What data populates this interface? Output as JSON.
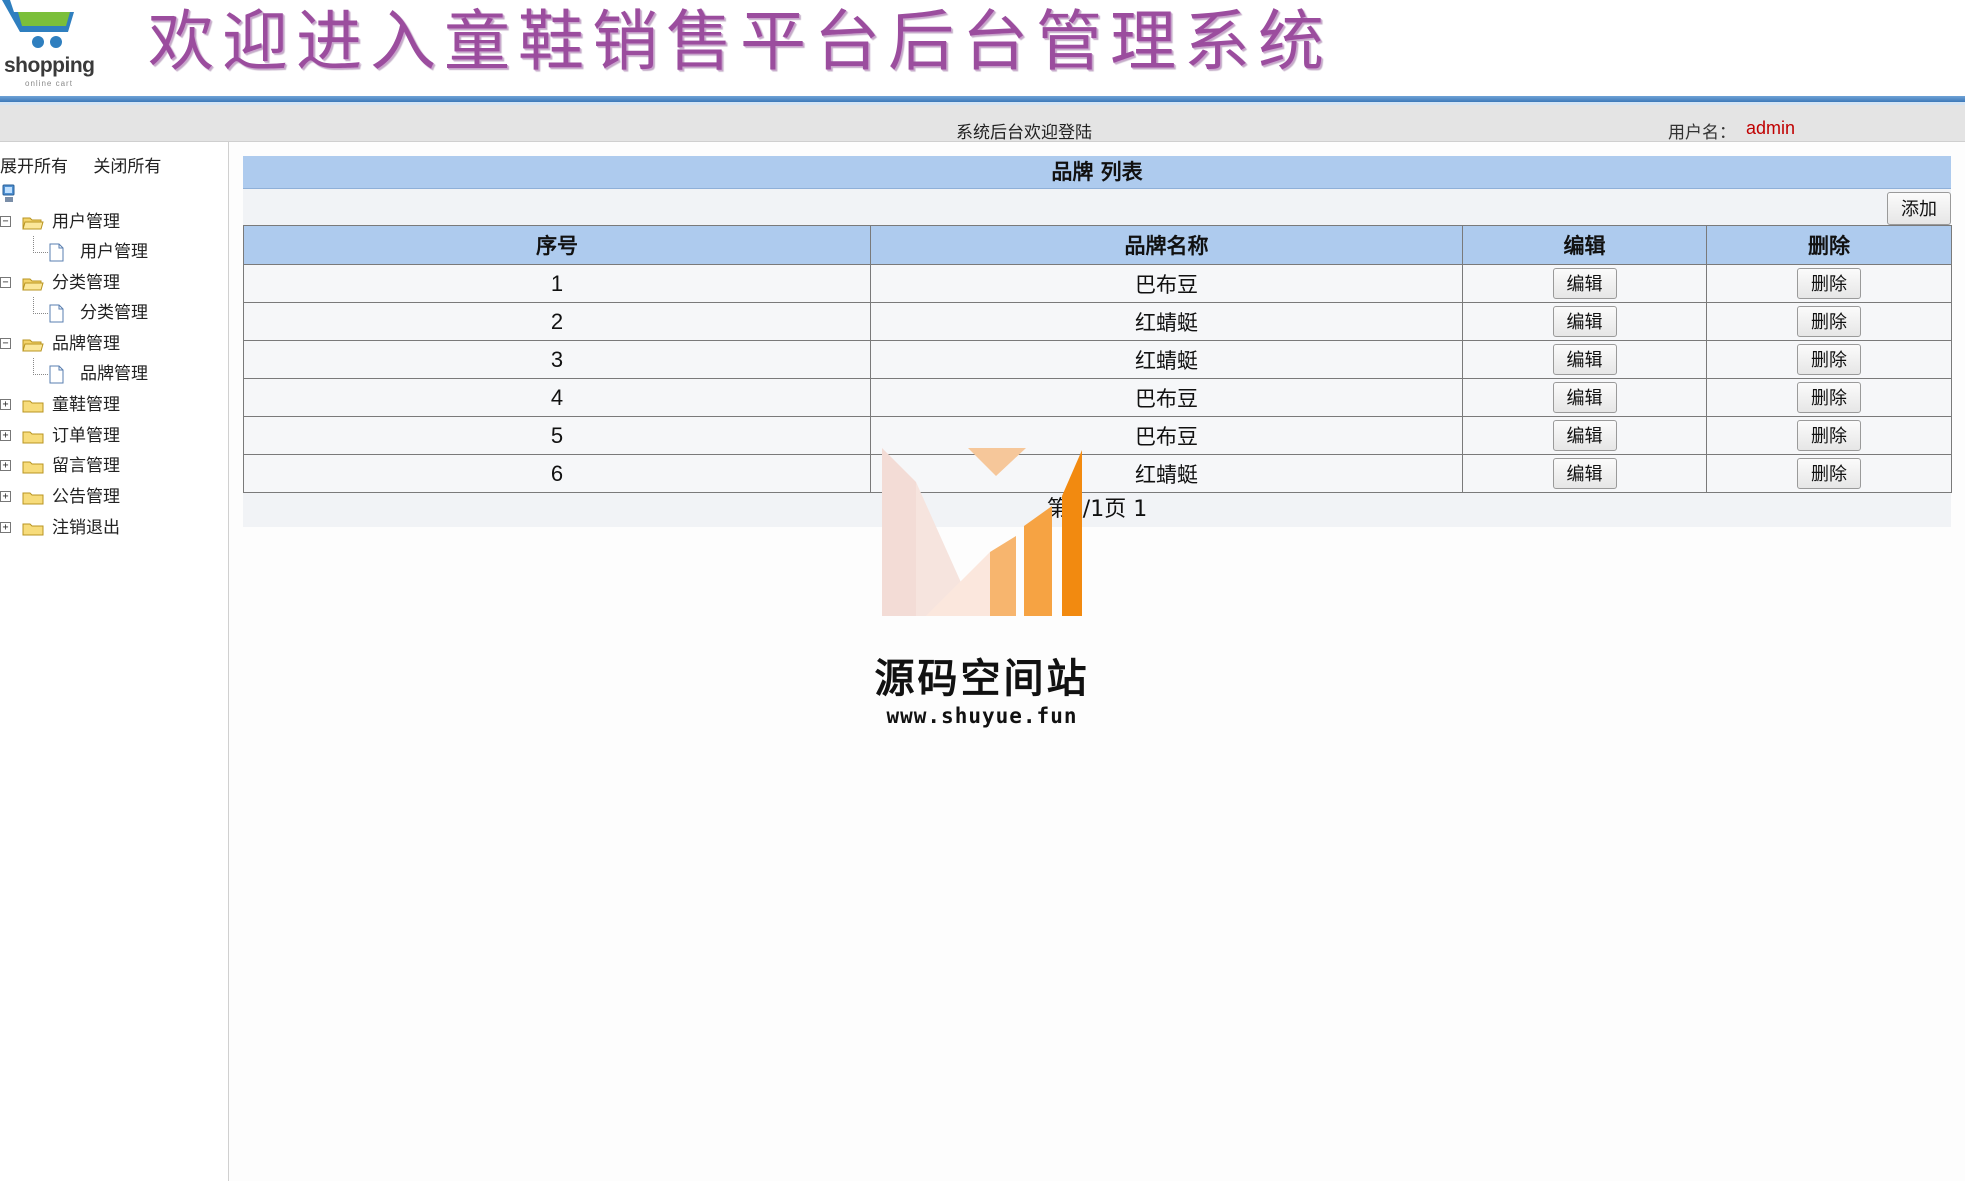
{
  "header": {
    "logo_text": "shopping",
    "logo_sub": "online cart",
    "title": "欢迎进入童鞋销售平台后台管理系统"
  },
  "status_bar": {
    "welcome": "系统后台欢迎登陆",
    "user_label": "用户名：",
    "user_value": "admin"
  },
  "sidebar": {
    "expand_all": "展开所有",
    "collapse_all": "关闭所有",
    "groups": [
      {
        "label": "用户管理",
        "expanded": true,
        "child": "用户管理"
      },
      {
        "label": "分类管理",
        "expanded": true,
        "child": "分类管理"
      },
      {
        "label": "品牌管理",
        "expanded": true,
        "child": "品牌管理"
      },
      {
        "label": "童鞋管理",
        "expanded": false
      },
      {
        "label": "订单管理",
        "expanded": false
      },
      {
        "label": "留言管理",
        "expanded": false
      },
      {
        "label": "公告管理",
        "expanded": false
      },
      {
        "label": "注销退出",
        "expanded": false
      }
    ]
  },
  "main": {
    "list_title": "品牌 列表",
    "add_label": "添加",
    "columns": [
      "序号",
      "品牌名称",
      "编辑",
      "删除"
    ],
    "edit_label": "编辑",
    "delete_label": "删除",
    "rows": [
      {
        "id": "1",
        "name": "巴布豆"
      },
      {
        "id": "2",
        "name": "红蜻蜓"
      },
      {
        "id": "3",
        "name": "红蜻蜓"
      },
      {
        "id": "4",
        "name": "巴布豆"
      },
      {
        "id": "5",
        "name": "巴布豆"
      },
      {
        "id": "6",
        "name": "红蜻蜓"
      }
    ],
    "pager": "第1/1页 1"
  },
  "watermark": {
    "title": "源码空间站",
    "url": "www.shuyue.fun"
  },
  "colors": {
    "title_purple": "#9b4d9e",
    "header_blue": "#aecbee",
    "user_red": "#c00000"
  }
}
